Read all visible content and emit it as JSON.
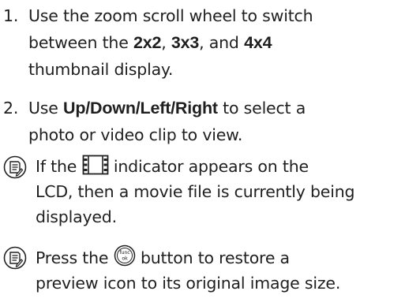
{
  "steps": [
    {
      "number": "1.",
      "line1": "Use the zoom scroll wheel to switch",
      "line2_before": "between the ",
      "opt1": "2x2",
      "sep1": ", ",
      "opt2": "3x3",
      "sep2": ", and ",
      "opt3": "4x4",
      "line3": "thumbnail display."
    },
    {
      "number": "2.",
      "before": "Use ",
      "bold": "Up/Down/Left/Right",
      "after_line1": " to select a",
      "line2": "photo or video clip to view."
    }
  ],
  "notes": [
    {
      "icon": "memo-icon",
      "before": "If the ",
      "inline_icon": "film-strip-icon",
      "after": " indicator appears on the",
      "line2": "LCD, then a movie file is currently being",
      "line3": "displayed."
    },
    {
      "icon": "memo-icon",
      "before": "Press the ",
      "button_top": "func",
      "button_bottom": "ok",
      "after": " button to restore a",
      "line2": "preview icon to its original image size."
    }
  ],
  "colors": {
    "text": "#1f1f1f",
    "icon": "#222222"
  }
}
